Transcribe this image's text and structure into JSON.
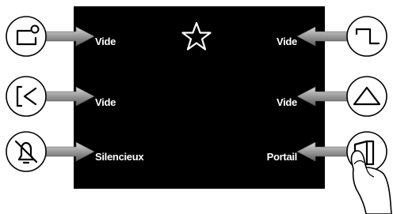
{
  "screen": {
    "background": "#000000",
    "favorite_icon": "star-outline-icon",
    "left": [
      {
        "label": "Vide",
        "icon": "auxiliary-contact-icon"
      },
      {
        "label": "Vide",
        "icon": "exit-arrow-icon"
      },
      {
        "label": "Silencieux",
        "icon": "bell-muted-icon"
      }
    ],
    "right": [
      {
        "label": "Vide",
        "icon": "stair-light-icon"
      },
      {
        "label": "Vide",
        "icon": "triangle-icon"
      },
      {
        "label": "Portail",
        "icon": "door-icon"
      }
    ]
  }
}
